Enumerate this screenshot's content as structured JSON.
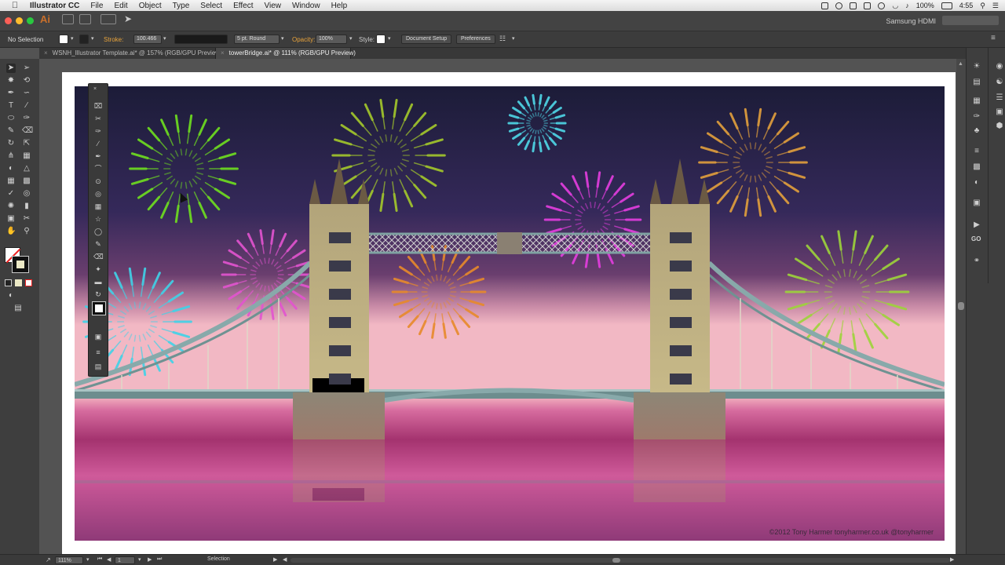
{
  "menubar": {
    "app_name": "Illustrator CC",
    "items": [
      "File",
      "Edit",
      "Object",
      "Type",
      "Select",
      "Effect",
      "View",
      "Window",
      "Help"
    ],
    "battery": "100%",
    "clock": "4:55"
  },
  "topbar": {
    "app_logo": "Ai",
    "workspace_label": "Samsung HDMI"
  },
  "control_bar": {
    "selection_label": "No Selection",
    "stroke_label": "Stroke:",
    "stroke_weight": "100.466",
    "brush_label": "5 pt. Round",
    "opacity_label": "Opacity:",
    "opacity_value": "100%",
    "style_label": "Style:",
    "document_setup_label": "Document Setup",
    "preferences_label": "Preferences"
  },
  "tabs": [
    {
      "label": "WSNH_Illustrator Template.ai* @ 157% (RGB/GPU Preview)",
      "active": false
    },
    {
      "label": "towerBridge.ai* @ 111% (RGB/GPU Preview)",
      "active": true
    }
  ],
  "artwork": {
    "credit": "©2012 Tony Harmer tonyharmer.co.uk @tonyharmer",
    "colors": {
      "sky_top": "#1f1f3f",
      "sky_mid": "#3d2f63",
      "sky_horizon": "#f0b6c4",
      "water_pink": "#d1549b",
      "tower_stone": "#a89a6a",
      "walkway_steel": "#7fa2a2"
    },
    "fireworks": [
      {
        "color": "#6fe01f"
      },
      {
        "color": "#a4c92b"
      },
      {
        "color": "#4fd8e8"
      },
      {
        "color": "#e3a03c"
      },
      {
        "color": "#e53ee0"
      },
      {
        "color": "#e354d0"
      },
      {
        "color": "#3fd3e8"
      },
      {
        "color": "#e88a2a"
      },
      {
        "color": "#9dd43a"
      }
    ]
  },
  "status_bar": {
    "zoom": "111%",
    "artboard_number": "1",
    "tool_name": "Selection"
  },
  "tools": {
    "left": [
      "selection-tool",
      "direct-selection-tool",
      "magic-wand-tool",
      "lasso-tool",
      "pen-tool",
      "curvature-tool",
      "type-tool",
      "line-tool",
      "rectangle-tool",
      "paintbrush-tool",
      "pencil-tool",
      "eraser-tool",
      "rotate-tool",
      "scale-tool",
      "width-tool",
      "free-transform-tool",
      "shape-builder-tool",
      "perspective-grid-tool",
      "mesh-tool",
      "gradient-tool",
      "eyedropper-tool",
      "blend-tool",
      "symbol-sprayer-tool",
      "column-graph-tool",
      "artboard-tool",
      "slice-tool",
      "hand-tool",
      "zoom-tool"
    ]
  }
}
